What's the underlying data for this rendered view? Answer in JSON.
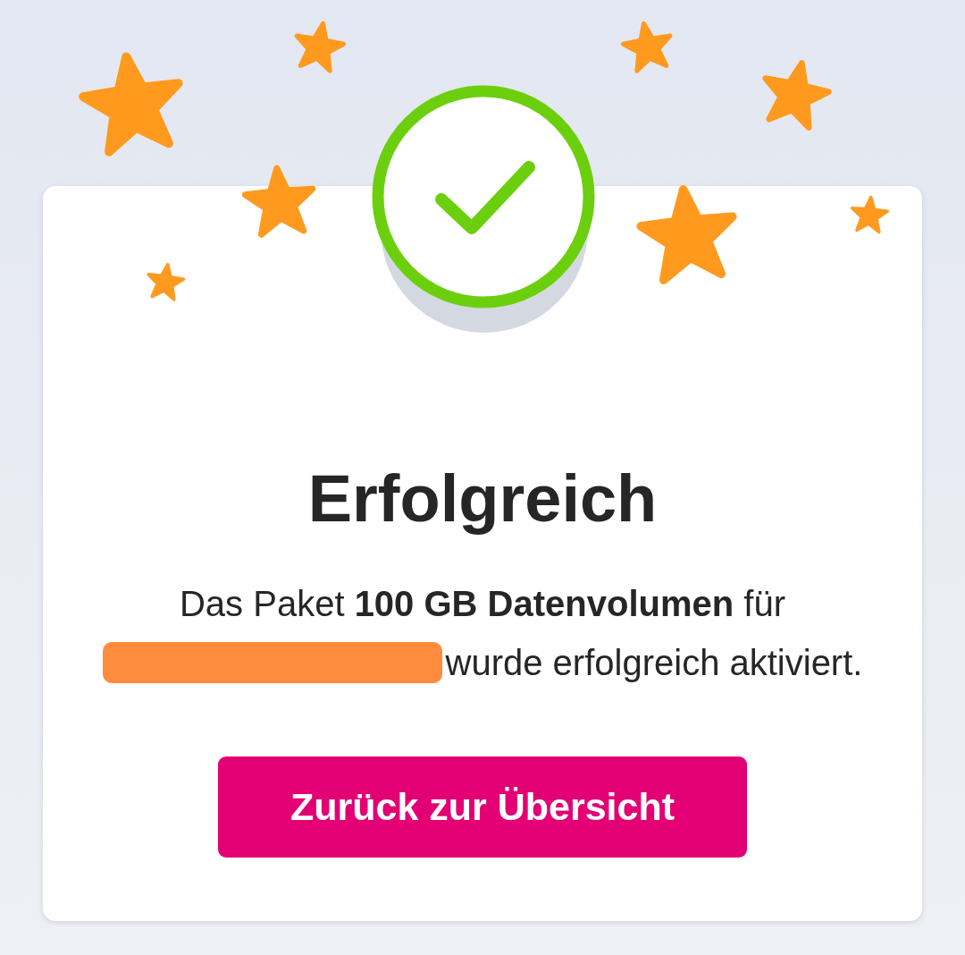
{
  "dialog": {
    "title": "Erfolgreich",
    "message_line_1": "Das Paket **100 GB Datenvolumen** für",
    "message_line_2": "wurde erfolgreich aktiviert.",
    "button": "Zurück zur Übersicht"
  }
}
